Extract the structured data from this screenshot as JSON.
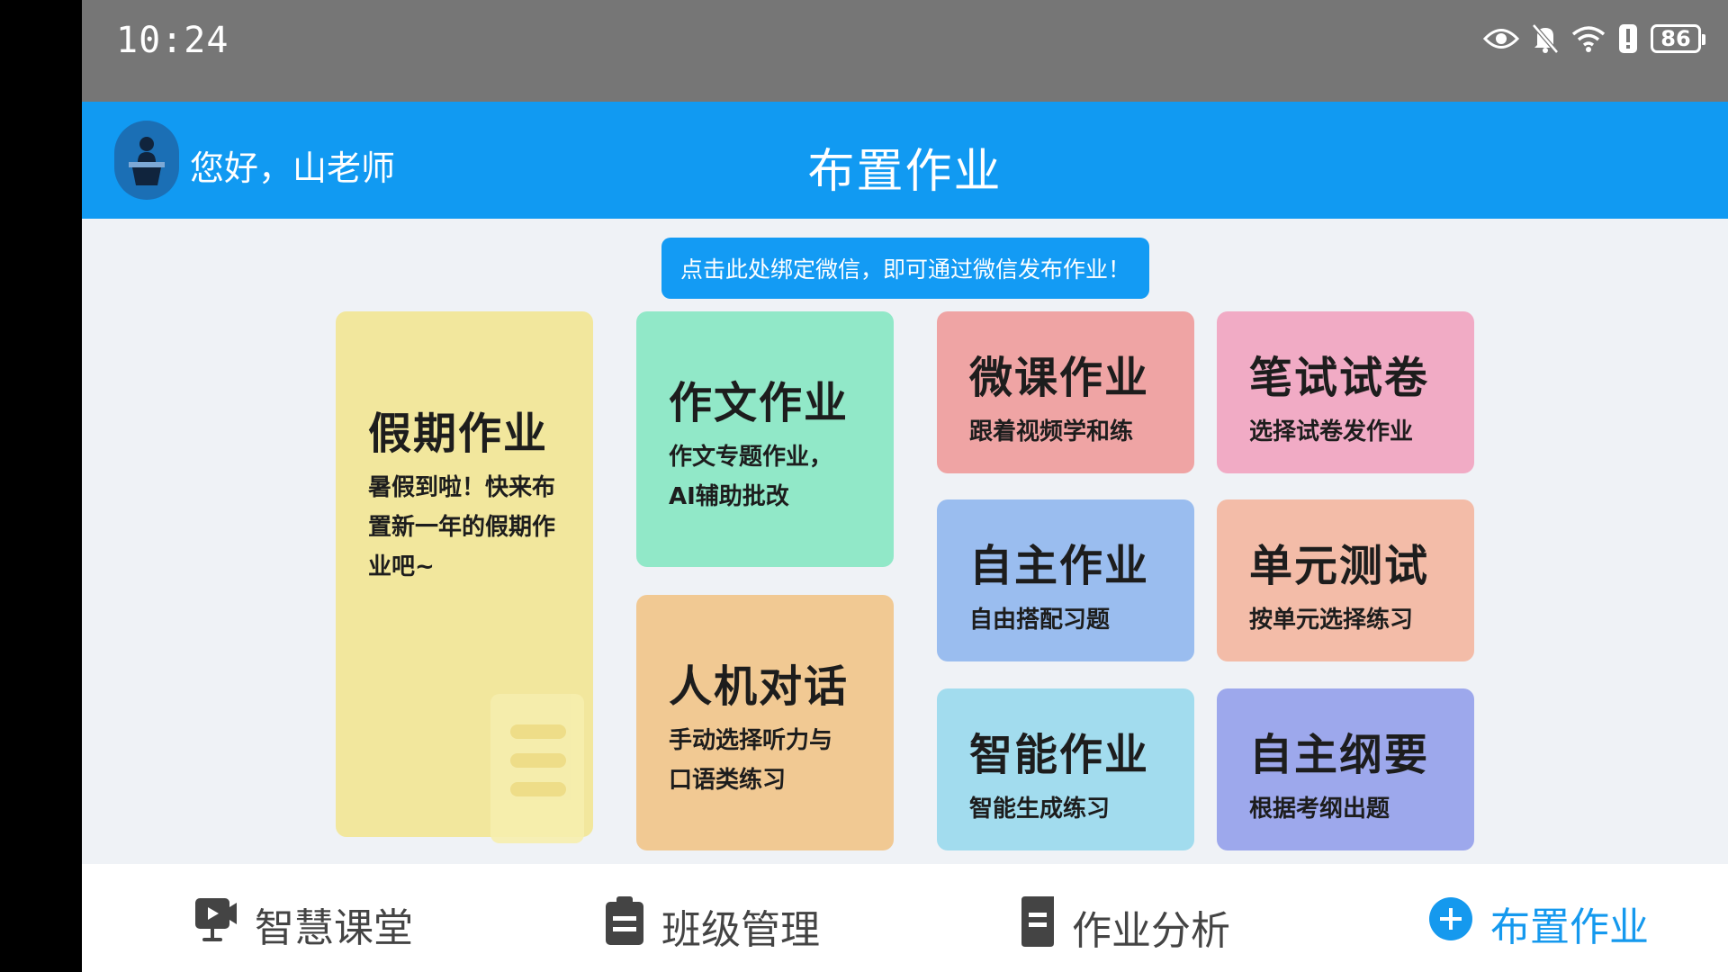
{
  "status_bar": {
    "time": "10:24",
    "battery": "86"
  },
  "header": {
    "greeting": "您好，山老师",
    "title": "布置作业"
  },
  "bind_banner": "点击此处绑定微信，即可通过微信发布作业！",
  "cards": {
    "holiday": {
      "title": "假期作业",
      "desc": "暑假到啦！快来布置新一年的假期作业吧~",
      "color": "#F2E79D"
    },
    "essay": {
      "title": "作文作业",
      "desc": "作文专题作业，AI辅助批改",
      "color": "#91E8C8"
    },
    "dialogue": {
      "title": "人机对话",
      "desc": "手动选择听力与口语类练习",
      "color": "#F1C993"
    },
    "microclass": {
      "title": "微课作业",
      "desc": "跟着视频学和练",
      "color": "#EFA4A4"
    },
    "written_exam": {
      "title": "笔试试卷",
      "desc": "选择试卷发作业",
      "color": "#F1ABC5"
    },
    "self_homework": {
      "title": "自主作业",
      "desc": "自由搭配习题",
      "color": "#9ABDEF"
    },
    "unit_test": {
      "title": "单元测试",
      "desc": "按单元选择练习",
      "color": "#F3BCA8"
    },
    "smart_homework": {
      "title": "智能作业",
      "desc": "智能生成练习",
      "color": "#A2DCEE"
    },
    "self_outline": {
      "title": "自主纲要",
      "desc": "根据考纲出题",
      "color": "#9DA8EC"
    }
  },
  "nav": {
    "smart_classroom": "智慧课堂",
    "class_management": "班级管理",
    "homework_analysis": "作业分析",
    "assign_homework": "布置作业",
    "active_color": "#1599EE"
  }
}
